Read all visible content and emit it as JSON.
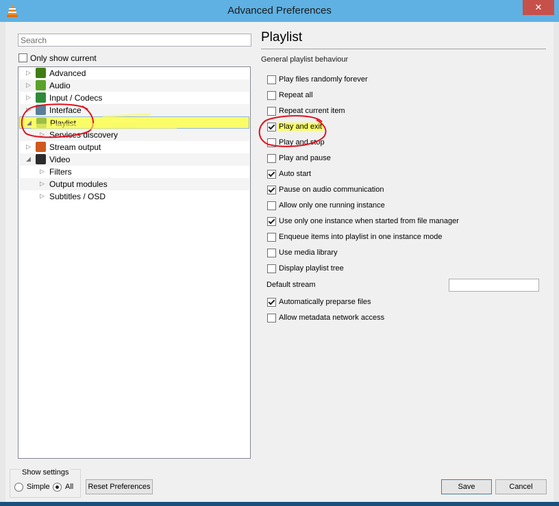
{
  "window": {
    "title": "Advanced Preferences",
    "close_glyph": "✕"
  },
  "search": {
    "placeholder": "Search",
    "value": ""
  },
  "only_show_current": {
    "label": "Only show current",
    "checked": false
  },
  "tree": {
    "nodes": [
      {
        "label": "Advanced",
        "level": 0,
        "arrow": "▷",
        "icon": "advanced-chip-icon",
        "color": "#3f7d14"
      },
      {
        "label": "Audio",
        "level": 0,
        "arrow": "▷",
        "icon": "music-note-icon",
        "color": "#59a12a"
      },
      {
        "label": "Input / Codecs",
        "level": 0,
        "arrow": "▷",
        "icon": "codecs-icon",
        "color": "#2e8b3a"
      },
      {
        "label": "Interface",
        "level": 0,
        "arrow": "▷",
        "icon": "interface-window-icon",
        "color": "#5a7f9a"
      },
      {
        "label": "Playlist",
        "level": 0,
        "arrow": "◢",
        "icon": "playlist-document-icon",
        "color": "#9bbf44"
      },
      {
        "label": "Services discovery",
        "level": 1,
        "arrow": "▷",
        "icon": "",
        "color": ""
      },
      {
        "label": "Stream output",
        "level": 0,
        "arrow": "▷",
        "icon": "stream-output-icon",
        "color": "#d1581f"
      },
      {
        "label": "Video",
        "level": 0,
        "arrow": "◢",
        "icon": "video-film-icon",
        "color": "#2b2b2b"
      },
      {
        "label": "Filters",
        "level": 1,
        "arrow": "▷",
        "icon": "",
        "color": ""
      },
      {
        "label": "Output modules",
        "level": 1,
        "arrow": "▷",
        "icon": "",
        "color": ""
      },
      {
        "label": "Subtitles / OSD",
        "level": 1,
        "arrow": "▷",
        "icon": "",
        "color": ""
      }
    ],
    "selected": "Playlist"
  },
  "panel": {
    "title": "Playlist",
    "section": "General playlist behaviour",
    "options": [
      {
        "label": "Play files randomly forever",
        "checked": false
      },
      {
        "label": "Repeat all",
        "checked": false
      },
      {
        "label": "Repeat current item",
        "checked": false
      },
      {
        "label": "Play and exit",
        "checked": true
      },
      {
        "label": "Play and stop",
        "checked": false
      },
      {
        "label": "Play and pause",
        "checked": false
      },
      {
        "label": "Auto start",
        "checked": true
      },
      {
        "label": "Pause on audio communication",
        "checked": true
      },
      {
        "label": "Allow only one running instance",
        "checked": false
      },
      {
        "label": "Use only one instance when started from file manager",
        "checked": true
      },
      {
        "label": "Enqueue items into playlist in one instance mode",
        "checked": false
      },
      {
        "label": "Use media library",
        "checked": false
      },
      {
        "label": "Display playlist tree",
        "checked": false
      }
    ],
    "default_stream": {
      "label": "Default stream",
      "value": ""
    },
    "options2": [
      {
        "label": "Automatically preparse files",
        "checked": true
      },
      {
        "label": "Allow metadata network access",
        "checked": false
      }
    ]
  },
  "show_settings": {
    "label": "Show settings",
    "simple_label": "Simple",
    "all_label": "All",
    "selected": "All"
  },
  "buttons": {
    "reset": "Reset Preferences",
    "save": "Save",
    "cancel": "Cancel"
  },
  "colors": {
    "highlight": "#fafc68",
    "annotation": "#e0101c",
    "titlebar": "#5fb1e3"
  }
}
